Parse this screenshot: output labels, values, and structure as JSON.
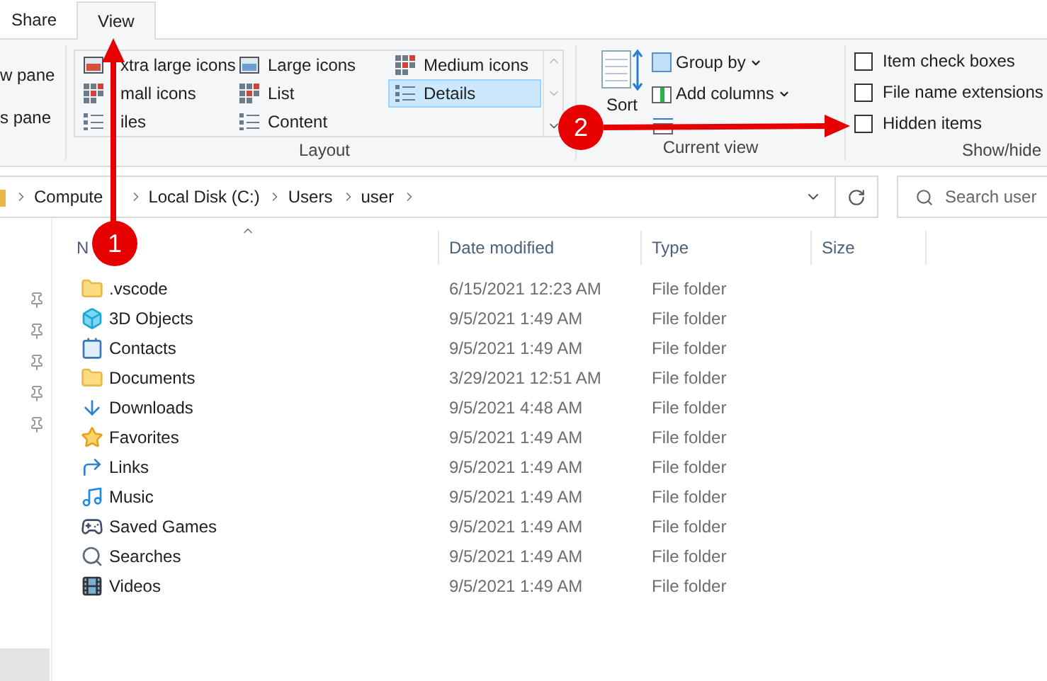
{
  "tabs": [
    {
      "label": "Share",
      "selected": false
    },
    {
      "label": "View",
      "selected": true
    }
  ],
  "ribbon": {
    "panes": [
      "w pane",
      "s pane"
    ],
    "layout": {
      "label": "Layout",
      "options": [
        {
          "label": "xtra large icons",
          "selected": false
        },
        {
          "label": "Large icons",
          "selected": false
        },
        {
          "label": "Medium icons",
          "selected": false
        },
        {
          "label": "mall icons",
          "selected": false
        },
        {
          "label": "List",
          "selected": false
        },
        {
          "label": "Details",
          "selected": true
        },
        {
          "label": "iles",
          "selected": false
        },
        {
          "label": "Content",
          "selected": false
        }
      ]
    },
    "current_view": {
      "label": "Current view",
      "sort": "Sort",
      "group_by": "Group by",
      "add_columns": "Add columns"
    },
    "show_hide": {
      "label": "Show/hide",
      "options": [
        {
          "label": "Item check boxes",
          "checked": false
        },
        {
          "label": "File name extensions",
          "checked": false
        },
        {
          "label": "Hidden items",
          "checked": false
        }
      ]
    }
  },
  "address_bar": {
    "breadcrumbs": [
      "Compute",
      "Local Disk (C:)",
      "Users",
      "user"
    ]
  },
  "search": {
    "placeholder": "Search user"
  },
  "file_list": {
    "columns": [
      "N",
      "Date modified",
      "Type",
      "Size"
    ],
    "rows": [
      {
        "name": ".vscode",
        "date": "6/15/2021 12:23 AM",
        "type": "File folder"
      },
      {
        "name": "3D Objects",
        "date": "9/5/2021 1:49 AM",
        "type": "File folder"
      },
      {
        "name": "Contacts",
        "date": "9/5/2021 1:49 AM",
        "type": "File folder"
      },
      {
        "name": "Documents",
        "date": "3/29/2021 12:51 AM",
        "type": "File folder"
      },
      {
        "name": "Downloads",
        "date": "9/5/2021 4:48 AM",
        "type": "File folder"
      },
      {
        "name": "Favorites",
        "date": "9/5/2021 1:49 AM",
        "type": "File folder"
      },
      {
        "name": "Links",
        "date": "9/5/2021 1:49 AM",
        "type": "File folder"
      },
      {
        "name": "Music",
        "date": "9/5/2021 1:49 AM",
        "type": "File folder"
      },
      {
        "name": "Saved Games",
        "date": "9/5/2021 1:49 AM",
        "type": "File folder"
      },
      {
        "name": "Searches",
        "date": "9/5/2021 1:49 AM",
        "type": "File folder"
      },
      {
        "name": "Videos",
        "date": "9/5/2021 1:49 AM",
        "type": "File folder"
      }
    ]
  },
  "annotations": [
    {
      "number": "1"
    },
    {
      "number": "2"
    }
  ]
}
